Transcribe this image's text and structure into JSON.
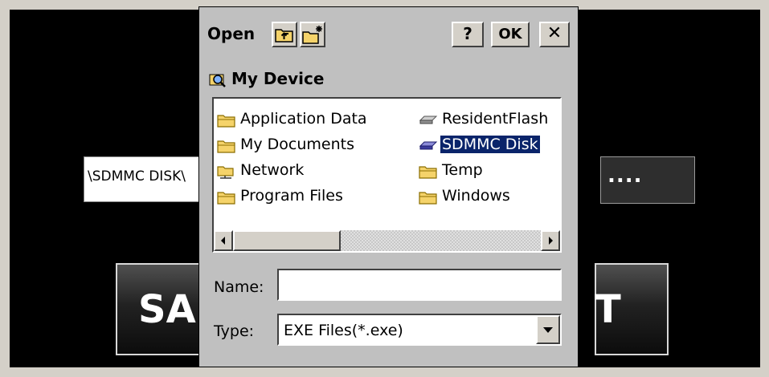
{
  "background_app": {
    "path_value": "\\SDMMC DISK\\",
    "browse_label": "....",
    "left_button_text": "SA",
    "right_button_text": "T"
  },
  "dialog": {
    "title": "Open",
    "help_label": "?",
    "ok_label": "OK",
    "close_label": "✕",
    "location": "My Device",
    "files": [
      {
        "name": "Application Data",
        "icon": "folder-icon",
        "selected": false
      },
      {
        "name": "My Documents",
        "icon": "folder-icon",
        "selected": false
      },
      {
        "name": "Network",
        "icon": "network-folder-icon",
        "selected": false
      },
      {
        "name": "Program Files",
        "icon": "folder-icon",
        "selected": false
      },
      {
        "name": "ResidentFlash",
        "icon": "storage-card-icon",
        "selected": false
      },
      {
        "name": "SDMMC Disk",
        "icon": "storage-card-icon",
        "selected": true
      },
      {
        "name": "Temp",
        "icon": "folder-icon",
        "selected": false
      },
      {
        "name": "Windows",
        "icon": "folder-icon",
        "selected": false
      }
    ],
    "name_label": "Name:",
    "name_value": "",
    "type_label": "Type:",
    "type_value": "EXE Files(*.exe)"
  },
  "colors": {
    "selection": "#0a246a",
    "dialog_face": "#c0c0c0",
    "folder": "#f5d36a"
  }
}
